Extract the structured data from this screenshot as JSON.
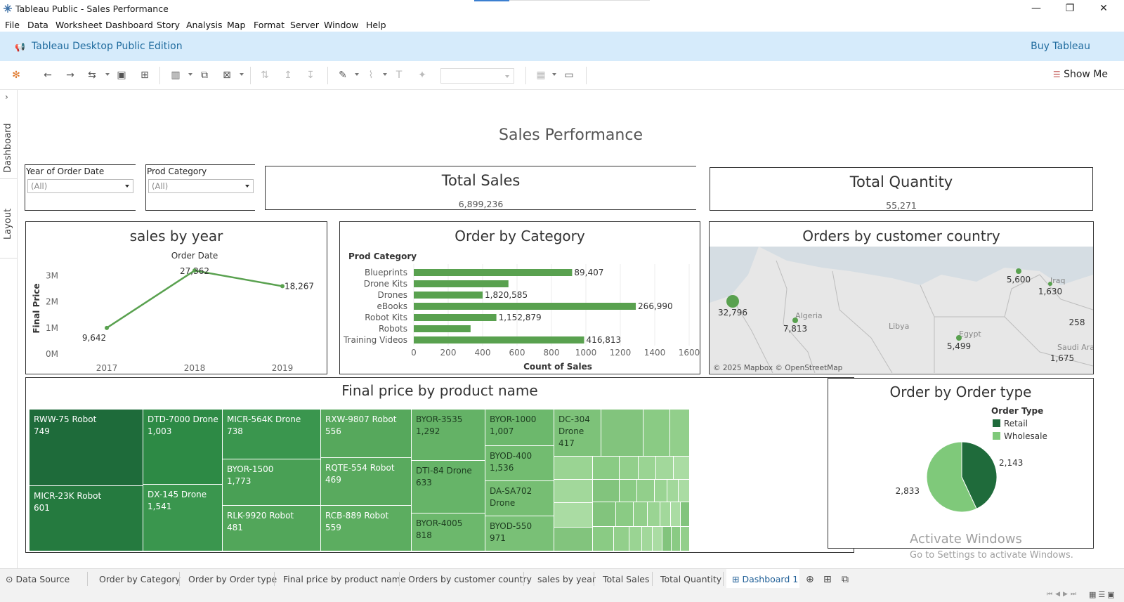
{
  "window": {
    "title": "Tableau Public - Sales Performance",
    "minimize": "—",
    "restore": "❐",
    "close": "✕"
  },
  "menu": [
    "File",
    "Data",
    "Worksheet",
    "Dashboard",
    "Story",
    "Analysis",
    "Map",
    "Format",
    "Server",
    "Window",
    "Help"
  ],
  "banner": {
    "edition": "Tableau Desktop Public Edition",
    "buy": "Buy Tableau"
  },
  "toolbar": {
    "show_me": "Show Me"
  },
  "side_tabs": {
    "dashboard": "Dashboard",
    "layout": "Layout"
  },
  "dashboard": {
    "title": "Sales Performance",
    "filters": [
      {
        "label": "Year of Order Date",
        "value": "(All)"
      },
      {
        "label": "Prod Category",
        "value": "(All)"
      }
    ],
    "kpis": [
      {
        "title": "Total Sales",
        "value": "6,899,236"
      },
      {
        "title": "Total Quantity",
        "value": "55,271"
      }
    ],
    "sales_by_year": {
      "title": "sales by year"
    },
    "order_by_category": {
      "title": "Order by Category"
    },
    "orders_by_country": {
      "title": "Orders by customer country"
    },
    "final_price": {
      "title": "Final price by product name"
    },
    "order_type": {
      "title": "Order by Order type"
    }
  },
  "chart_data": [
    {
      "type": "line",
      "title": "sales by year",
      "column_header": "Order Date",
      "ylabel": "Final Price",
      "x": [
        "2017",
        "2018",
        "2019"
      ],
      "y": [
        1000000,
        3200000,
        2600000
      ],
      "point_labels": [
        "9,642",
        "27,362",
        "18,267"
      ],
      "yticks": [
        "0M",
        "1M",
        "2M",
        "3M"
      ],
      "ylim": [
        0,
        3500000
      ],
      "color": "#59a14f"
    },
    {
      "type": "bar",
      "title": "Order by Category",
      "row_header": "Prod Category",
      "xlabel": "Count of Sales",
      "categories": [
        "Blueprints",
        "Drone Kits",
        "Drones",
        "eBooks",
        "Robot Kits",
        "Robots",
        "Training Videos"
      ],
      "values": [
        920,
        550,
        400,
        1290,
        480,
        330,
        990
      ],
      "data_labels": [
        "89,407",
        "",
        "1,820,585",
        "266,990",
        "1,152,879",
        "",
        "416,813"
      ],
      "xticks": [
        "0",
        "200",
        "400",
        "600",
        "800",
        "1000",
        "1200",
        "1400",
        "1600"
      ],
      "xlim": [
        0,
        1600
      ],
      "color": "#59a14f"
    },
    {
      "type": "map",
      "title": "Orders by customer country",
      "attribution": "© 2025 Mapbox © OpenStreetMap",
      "place_labels": [
        "Algeria",
        "Libya",
        "Egypt",
        "Iraq",
        "Saudi Arabia"
      ],
      "points": [
        {
          "value": "32,796",
          "size": 9
        },
        {
          "value": "7,813",
          "size": 4
        },
        {
          "value": "5,499",
          "size": 4
        },
        {
          "value": "5,600",
          "size": 4
        },
        {
          "value": "1,630",
          "size": 3
        },
        {
          "value": "258",
          "size": 0
        },
        {
          "value": "1,675",
          "size": 0
        }
      ]
    },
    {
      "type": "treemap",
      "title": "Final price by product name",
      "items": [
        {
          "name": "RWW-75 Robot",
          "value": "749",
          "shade": "#1e6b3a"
        },
        {
          "name": "MICR-23K Robot",
          "value": "601",
          "shade": "#257a3f"
        },
        {
          "name": "DTD-7000 Drone",
          "value": "1,003",
          "shade": "#2d8a45"
        },
        {
          "name": "DX-145 Drone",
          "value": "1,541",
          "shade": "#3a964e"
        },
        {
          "name": "MICR-564K Drone",
          "value": "738",
          "shade": "#3a964e"
        },
        {
          "name": "BYOR-1500",
          "value": "1,773",
          "shade": "#49a055"
        },
        {
          "name": "RLK-9920 Robot",
          "value": "481",
          "shade": "#52a65a"
        },
        {
          "name": "RXW-9807 Robot",
          "value": "556",
          "shade": "#56a85c"
        },
        {
          "name": "RQTE-554 Robot",
          "value": "469",
          "shade": "#59aa5e"
        },
        {
          "name": "RCB-889 Robot",
          "value": "559",
          "shade": "#5cad60"
        },
        {
          "name": "BYOR-3535",
          "value": "1,292",
          "shade": "#64b266"
        },
        {
          "name": "DTI-84 Drone",
          "value": "633",
          "shade": "#66b468"
        },
        {
          "name": "BYOR-4005",
          "value": "818",
          "shade": "#6cb86c"
        },
        {
          "name": "BYOR-1000",
          "value": "1,007",
          "shade": "#6cb86c"
        },
        {
          "name": "BYOD-400",
          "value": "1,536",
          "shade": "#72bc70"
        },
        {
          "name": "DA-SA702 Drone",
          "value": "",
          "shade": "#76be73"
        },
        {
          "name": "BYOD-550",
          "value": "971",
          "shade": "#79c076"
        },
        {
          "name": "DC-304 Drone",
          "value": "417",
          "shade": "#7dc279"
        }
      ]
    },
    {
      "type": "pie",
      "title": "Order by Order type",
      "legend_title": "Order Type",
      "series": [
        {
          "name": "Retail",
          "value": 2143,
          "label": "2,143",
          "color": "#1f6b3b"
        },
        {
          "name": "Wholesale",
          "value": 2833,
          "label": "2,833",
          "color": "#7fc97a"
        }
      ]
    }
  ],
  "sheet_tabs": [
    "Data Source",
    "Order by Category",
    "Order by Order type",
    "Final price by product name",
    "Orders by customer country",
    "sales by year",
    "Total Sales",
    "Total Quantity",
    "Dashboard 1"
  ],
  "watermark": {
    "line1": "Activate Windows",
    "line2": "Go to Settings to activate Windows."
  }
}
